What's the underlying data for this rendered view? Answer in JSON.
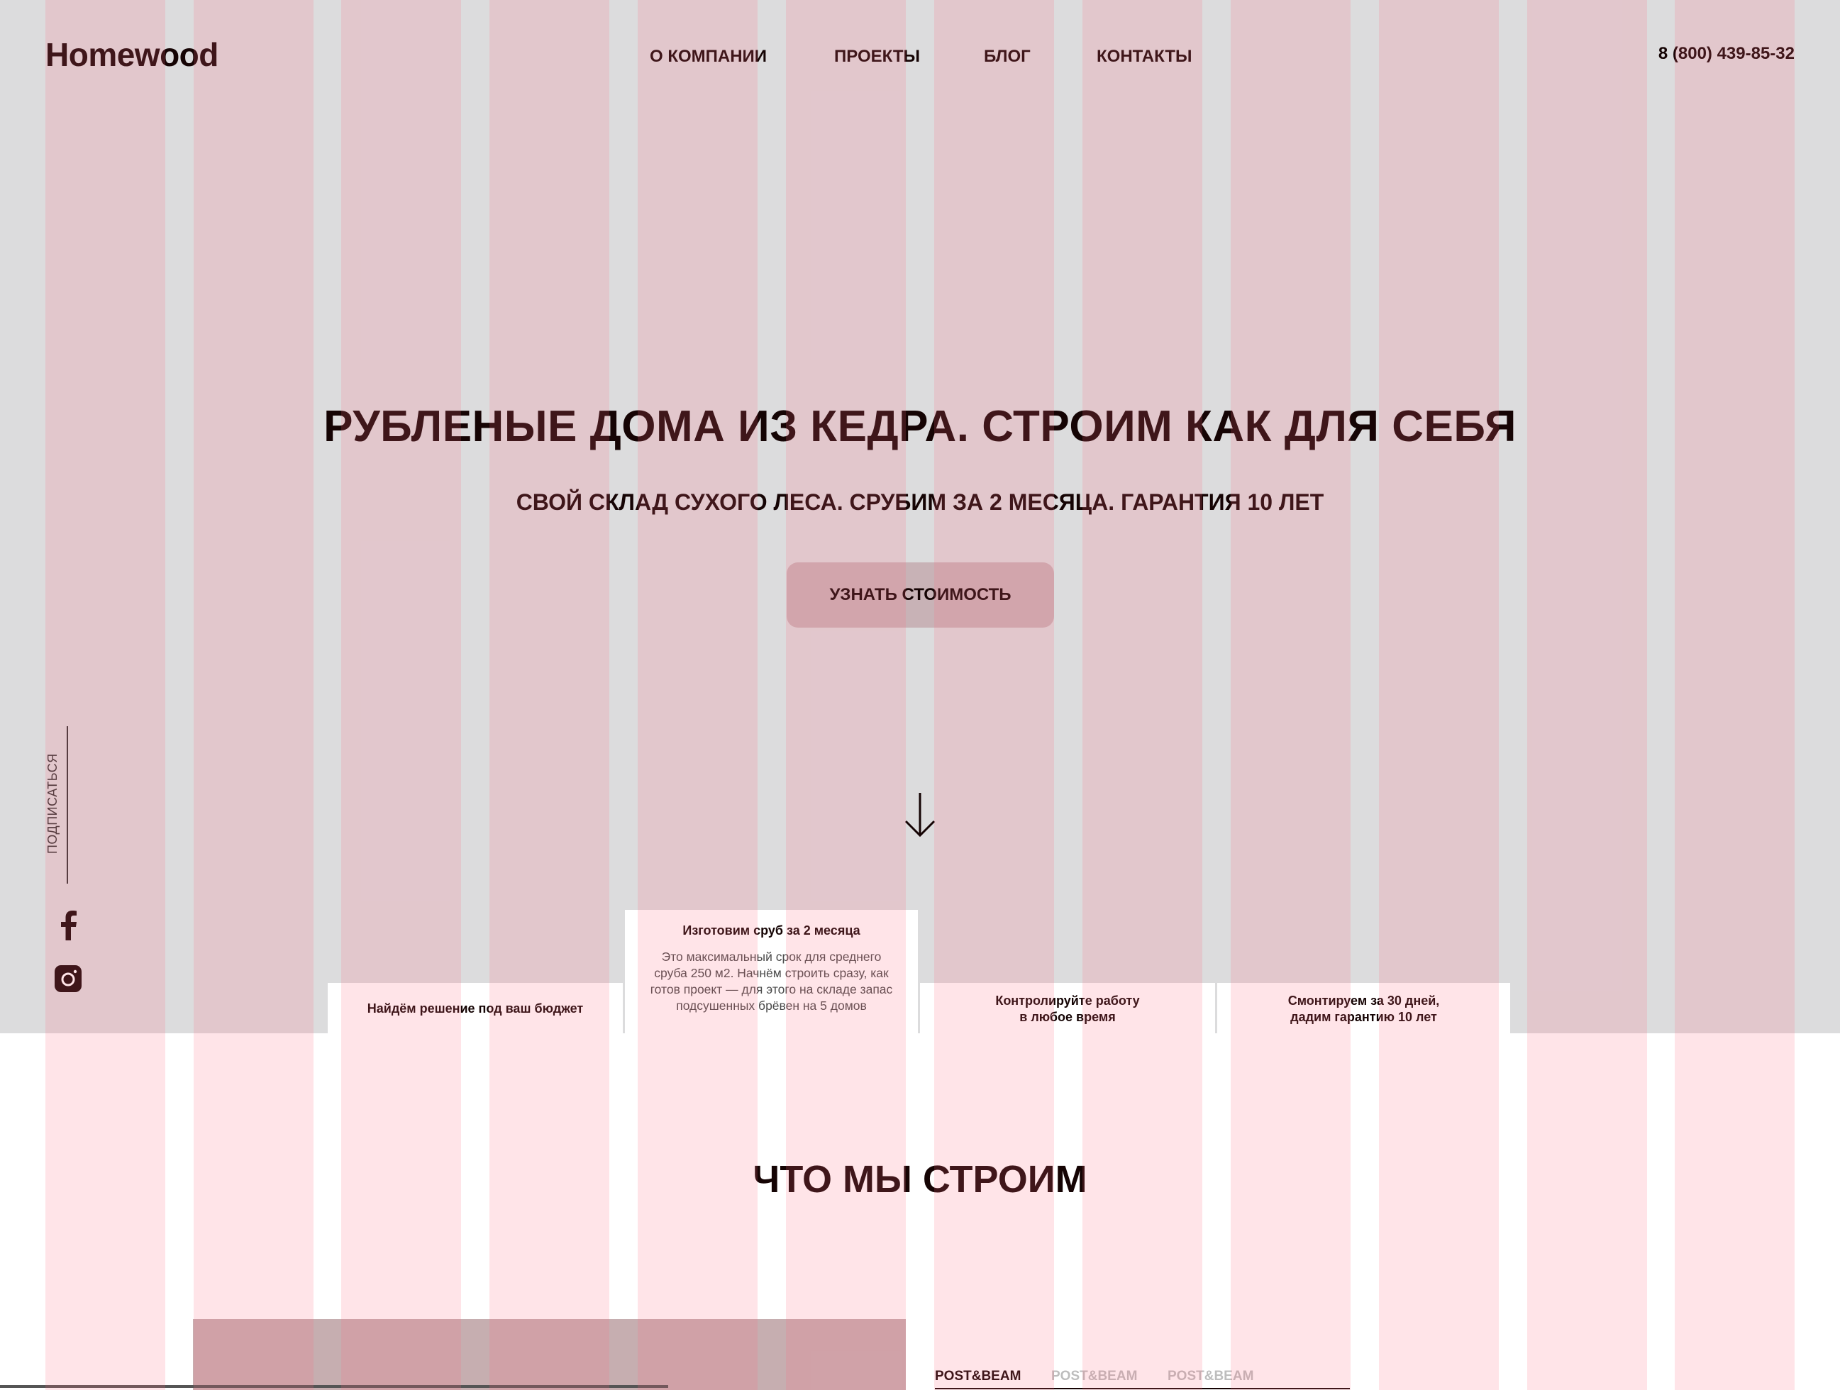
{
  "header": {
    "logo": "Homewood",
    "nav": [
      {
        "label": "О КОМПАНИИ"
      },
      {
        "label": "ПРОЕКТЫ"
      },
      {
        "label": "БЛОГ"
      },
      {
        "label": "КОНТАКТЫ"
      }
    ],
    "phone": "8 (800) 439-85-32"
  },
  "hero": {
    "title": "РУБЛЕНЫЕ ДОМА ИЗ КЕДРА. СТРОИМ КАК ДЛЯ СЕБЯ",
    "subtitle": "СВОЙ СКЛАД СУХОГО ЛЕСА. СРУБИМ ЗА 2 МЕСЯЦА. ГАРАНТИЯ 10 ЛЕТ",
    "cta_label": "УЗНАТЬ СТОИМОСТЬ",
    "scroll_icon": "arrow-down-icon"
  },
  "sidebar": {
    "subscribe_label": "ПОДПИСАТЬСЯ",
    "social": [
      {
        "icon": "facebook-icon"
      },
      {
        "icon": "instagram-icon"
      }
    ]
  },
  "features": [
    {
      "title": "Найдём решение под ваш бюджет",
      "text": ""
    },
    {
      "title": "Изготовим сруб за 2 месяца",
      "text": "Это максимальный срок для среднего\nсруба 250 м2. Начнём строить сразу, как\nготов проект — для этого на складе запас\nподсушенных брёвен на 5 домов"
    },
    {
      "title": "Контролируйте работу\nв любое время",
      "text": ""
    },
    {
      "title": "Смонтируем за 30 дней,\nдадим гарантию 10 лет",
      "text": ""
    }
  ],
  "section": {
    "title": "ЧТО МЫ СТРОИМ",
    "tabs": [
      {
        "label": "POST&BEAM",
        "active": true
      },
      {
        "label": "POST&BEAM",
        "active": false
      },
      {
        "label": "POST&BEAM",
        "active": false
      }
    ]
  },
  "colors": {
    "text": "#150404",
    "hero_background": "#dcdcdd",
    "cta_background": "#c8b2b6",
    "grid_overlay": "#ff6982",
    "tab_inactive": "#bdbdbd"
  }
}
